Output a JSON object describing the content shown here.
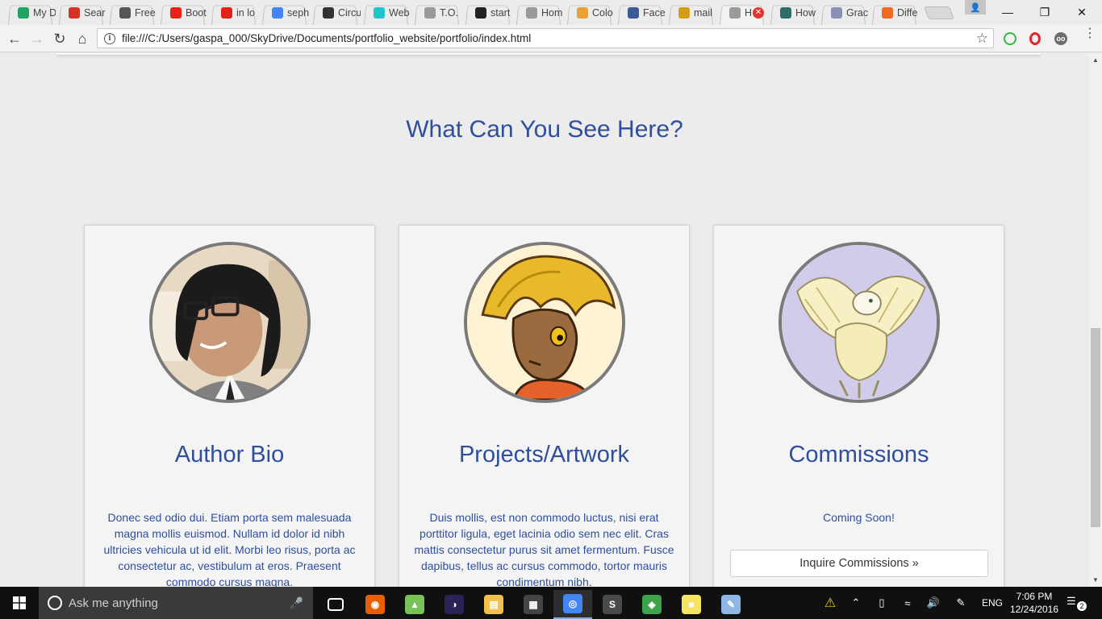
{
  "browser": {
    "tabs": [
      {
        "title": "My D",
        "icon": "drive-icon",
        "color": "#1fa463"
      },
      {
        "title": "Sear",
        "icon": "gmail-icon",
        "color": "#d93025"
      },
      {
        "title": "Free",
        "icon": "codepen-icon",
        "color": "#555555"
      },
      {
        "title": "Boot",
        "icon": "youtube-icon",
        "color": "#e62117"
      },
      {
        "title": "in lo",
        "icon": "youtube-icon",
        "color": "#e62117"
      },
      {
        "title": "seph",
        "icon": "google-icon",
        "color": "#4285f4"
      },
      {
        "title": "Circu",
        "icon": "scribd-icon",
        "color": "#333333"
      },
      {
        "title": "Web",
        "icon": "canva-icon",
        "color": "#20c4cb"
      },
      {
        "title": "T.O.",
        "icon": "page-icon",
        "color": "#9a9a9a"
      },
      {
        "title": "start",
        "icon": "github-icon",
        "color": "#222222"
      },
      {
        "title": "Hom",
        "icon": "page-icon",
        "color": "#9a9a9a"
      },
      {
        "title": "Colo",
        "icon": "colors-icon",
        "color": "#e9a23b"
      },
      {
        "title": "Face",
        "icon": "facebook-icon",
        "color": "#3b5998"
      },
      {
        "title": "mail",
        "icon": "r-logo-icon",
        "color": "#d49b14"
      },
      {
        "title": "H",
        "icon": "page-icon",
        "color": "#9a9a9a",
        "active": true
      },
      {
        "title": "How",
        "icon": "drop-icon",
        "color": "#2c6e6a"
      },
      {
        "title": "Grac",
        "icon": "folder-icon",
        "color": "#8a8fb8"
      },
      {
        "title": "Diffe",
        "icon": "f-logo-icon",
        "color": "#f26b21"
      }
    ],
    "url": "file:///C:/Users/gaspa_000/SkyDrive/Documents/portfolio_website/portfolio/index.html"
  },
  "page": {
    "section_title": "What Can You See Here?",
    "cards": [
      {
        "title": "Author Bio",
        "image": "author-photo",
        "text": "Donec sed odio dui. Etiam porta sem malesuada magna mollis euismod. Nullam id dolor id nibh ultricies vehicula ut id elit. Morbi leo risus, porta ac consectetur ac, vestibulum at eros. Praesent commodo cursus magna."
      },
      {
        "title": "Projects/Artwork",
        "image": "artwork-character",
        "text": "Duis mollis, est non commodo luctus, nisi erat porttitor ligula, eget lacinia odio sem nec elit. Cras mattis consectetur purus sit amet fermentum. Fusce dapibus, tellus ac cursus commodo, tortor mauris condimentum nibh."
      },
      {
        "title": "Commissions",
        "image": "commission-griffin",
        "text": "Coming Soon!",
        "button": "Inquire Commissions »"
      }
    ]
  },
  "taskbar": {
    "search_placeholder": "Ask me anything",
    "language": "ENG",
    "time": "7:06 PM",
    "date": "12/24/2016",
    "notification_count": "2",
    "apps": [
      {
        "name": "task-view-icon"
      },
      {
        "name": "firefox-icon",
        "color": "#e66000"
      },
      {
        "name": "android-studio-icon",
        "color": "#78c257"
      },
      {
        "name": "eclipse-icon",
        "color": "#2c2255"
      },
      {
        "name": "file-explorer-icon",
        "color": "#f2c14e"
      },
      {
        "name": "store-icon",
        "color": "#444444"
      },
      {
        "name": "chrome-icon",
        "color": "#4285f4",
        "active": true
      },
      {
        "name": "sublime-icon",
        "color": "#4a4a4a"
      },
      {
        "name": "maps-icon",
        "color": "#3fa34d"
      },
      {
        "name": "sticky-notes-icon",
        "color": "#f7e463"
      },
      {
        "name": "paint-icon",
        "color": "#8fb6e6"
      }
    ]
  },
  "colors": {
    "heading": "#2f4f9c",
    "page_bg": "#ececec",
    "card_bg": "#f4f4f4"
  }
}
